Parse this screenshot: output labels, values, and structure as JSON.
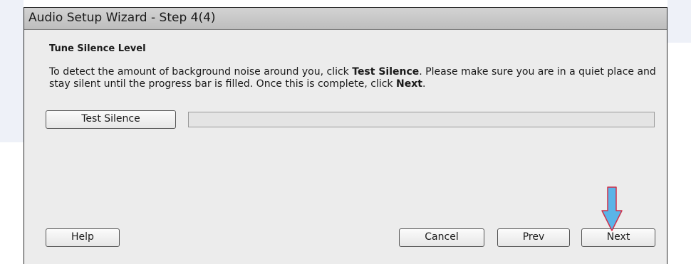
{
  "window": {
    "title": "Audio Setup Wizard - Step 4(4)"
  },
  "content": {
    "heading": "Tune Silence Level",
    "instructions": {
      "part1": "To detect the amount of background noise around you, click ",
      "bold1": "Test Silence",
      "part2": ". Please make sure you are in a quiet place and stay silent until the progress bar is filled. Once this is complete, click ",
      "bold2": "Next",
      "part3": "."
    }
  },
  "test": {
    "button_label": "Test Silence",
    "progress_fraction": 0
  },
  "footer": {
    "help_label": "Help",
    "cancel_label": "Cancel",
    "prev_label": "Prev",
    "next_label": "Next"
  },
  "annotation": {
    "arrow_icon": "down-arrow-icon",
    "arrow_color": "#5ab4e8",
    "arrow_outline": "#d0304a"
  }
}
